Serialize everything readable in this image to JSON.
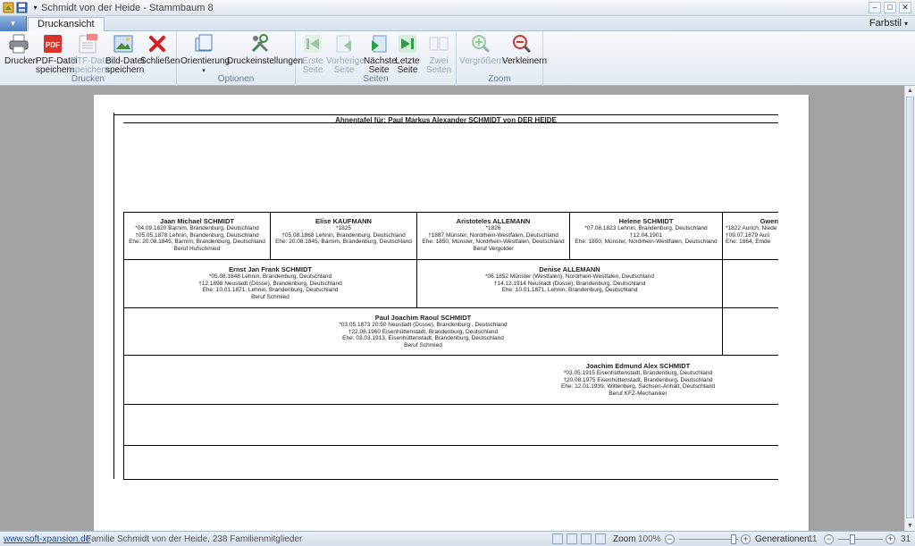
{
  "window": {
    "title": "Schmidt von der Heide - Stammbaum 8",
    "tab_active": "Druckansicht",
    "farbstil": "Farbstil",
    "app_button": "▾"
  },
  "ribbon": {
    "groups": {
      "drucken": "Drucken",
      "optionen": "Optionen",
      "seiten": "Seiten",
      "zoom": "Zoom"
    },
    "buttons": {
      "drucken": "Drucken",
      "pdf_1": "PDF-Datei",
      "pdf_2": "speichern",
      "rtf_1": "RTF-Datei",
      "rtf_2": "speichern",
      "bild_1": "Bild-Datei",
      "bild_2": "speichern",
      "schliessen": "Schließen",
      "orientierung": "Orientierung",
      "druckeinstellungen": "Druckeinstellungen",
      "erste_1": "Erste",
      "erste_2": "Seite",
      "vorherige_1": "Vorherige",
      "vorherige_2": "Seite",
      "naechste_1": "Nächste",
      "naechste_2": "Seite",
      "letzte_1": "Letzte",
      "letzte_2": "Seite",
      "zwei_1": "Zwei",
      "zwei_2": "Seiten",
      "vergroessern": "Vergrößern",
      "verkleinern": "Verkleinern"
    }
  },
  "sheet": {
    "title": "Ahnentafel für: Paul Markus Alexander SCHMIDT von DER HEIDE",
    "gen4": [
      {
        "name": "Jaan Michael SCHMIDT",
        "l1": "*04.09.1820 Barnim, Brandenburg, Deutschland",
        "l2": "†05.05.1878 Lehnin, Brandenburg, Deutschland",
        "l3": "Ehe:  20.08.1845, Barnim, Brandenburg, Deutschland",
        "l4": "Beruf Hufschmied"
      },
      {
        "name": "Elise KAUFMANN",
        "l1": "*1825",
        "l2": "†05.08.1868 Lehnin, Brandenburg, Deutschland",
        "l3": "Ehe:  20.08.1845, Barnim, Brandenburg, Deutschland",
        "l4": ""
      },
      {
        "name": "Aristoteles ALLEMANN",
        "l1": "*1826",
        "l2": "†1887 Münster, Nordrhein-Westfalen, Deutschland",
        "l3": "Ehe:  1850, Münster, Nordrhein-Westfalen, Deutschland",
        "l4": "Beruf Vergolder"
      },
      {
        "name": "Helene SCHMIDT",
        "l1": "*07.08.1823 Lehnin, Brandenburg, Deutschland",
        "l2": "†12.04.1901",
        "l3": "Ehe:  1850, Münster, Nordrhein-Westfalen, Deutschland",
        "l4": ""
      },
      {
        "name": "Gwen",
        "l1": "*1822 Aurich, Niede",
        "l2": "†09.07.1879 Auri",
        "l3": "Ehe:  1864, Emde",
        "l4": ""
      }
    ],
    "gen3": [
      {
        "name": "Ernst Jan Frank SCHMIDT",
        "l1": "*05.08.1848 Lehnin, Brandenburg, Deutschland",
        "l2": "†12.1898 Neustadt (Dosse), Brandenburg, Deutschland",
        "l3": "Ehe:  10.01.1871, Lehnin, Brandenburg, Deutschland",
        "l4": "Beruf Schmied"
      },
      {
        "name": "Denise ALLEMANN",
        "l1": "*06.1852 Münster (Westfalen), Nordrhein-Westfalen, Deutschland",
        "l2": "†14.12.1914 Neustadt (Dosse), Brandenburg, Deutschland",
        "l3": "Ehe:  10.01.1871, Lehnin, Brandenburg, Deutschland",
        "l4": ""
      }
    ],
    "gen2": {
      "name": "Paul Joachim Raoul SCHMIDT",
      "l1": "*03.05.1873 20:50 Neustadt (Dosse), Brandenburg  , Deutschland",
      "l2": "†22.08.1960 Eisenhüttenstadt, Brandenburg, Deutschland",
      "l3": "Ehe:  03.03.1913, Eisenhüttenstadt, Brandenburg, Deutschland",
      "l4": "Beruf Schmied"
    },
    "gen1": {
      "name": "Joachim Edmund Alex SCHMIDT",
      "l1": "*03.05.1915 Eisenhüttenstadt, Brandenburg, Deutschland",
      "l2": "†20.08.1975 Eisenhüttenstadt, Brandenburg, Deutschland",
      "l3": "Ehe:  12.01.1939, Wittenberg, Sachsen-Anhalt, Deutschland",
      "l4": "Beruf KFZ-Mechaniker"
    }
  },
  "statusbar": {
    "link": "www.soft-xpansion.de",
    "info": "Familie Schmidt von der Heide, 238 Familienmitglieder",
    "zoom_label": "Zoom",
    "zoom_value": "100%",
    "generationen_label": "Generationen:",
    "generationen_value": "11",
    "generationen_max": "31"
  },
  "colors": {
    "accent": "#4f7fbf",
    "pdf_red": "#d9342b",
    "close_red": "#d62020",
    "nav_green": "#2f9e44",
    "workspace": "#a3a3a3"
  }
}
